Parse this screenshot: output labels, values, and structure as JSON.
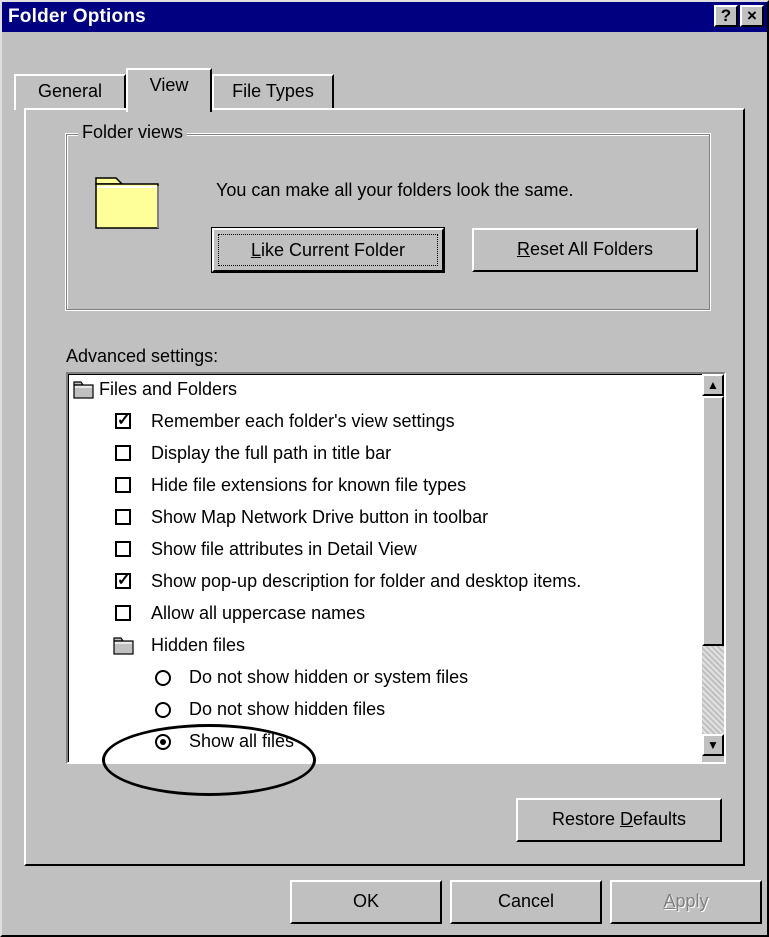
{
  "window": {
    "title": "Folder Options",
    "help_button": "?",
    "close_button": "×"
  },
  "tabs": [
    {
      "label": "General",
      "selected": false
    },
    {
      "label": "View",
      "selected": true
    },
    {
      "label": "File Types",
      "selected": false
    }
  ],
  "folder_views": {
    "legend": "Folder views",
    "description": "You can make all your folders look the same.",
    "like_current_pre": "",
    "like_current_key": "L",
    "like_current_post": "ike Current Folder",
    "reset_all_pre": "",
    "reset_all_key": "R",
    "reset_all_post": "eset All Folders"
  },
  "advanced": {
    "label": "Advanced settings:",
    "items": [
      {
        "kind": "folder",
        "label": "Files and Folders"
      },
      {
        "kind": "checkbox",
        "checked": true,
        "label": "Remember each folder's view settings"
      },
      {
        "kind": "checkbox",
        "checked": false,
        "label": "Display the full path in title bar"
      },
      {
        "kind": "checkbox",
        "checked": false,
        "label": "Hide file extensions for known file types"
      },
      {
        "kind": "checkbox",
        "checked": false,
        "label": "Show Map Network Drive button in toolbar"
      },
      {
        "kind": "checkbox",
        "checked": false,
        "label": "Show file attributes in Detail View"
      },
      {
        "kind": "checkbox",
        "checked": true,
        "label": "Show pop-up description for folder and desktop items."
      },
      {
        "kind": "checkbox",
        "checked": false,
        "label": "Allow all uppercase names"
      },
      {
        "kind": "folder",
        "label": "Hidden files"
      },
      {
        "kind": "radio",
        "checked": false,
        "label": "Do not show hidden or system files"
      },
      {
        "kind": "radio",
        "checked": false,
        "label": "Do not show hidden files"
      },
      {
        "kind": "radio",
        "checked": true,
        "label": "Show all files"
      }
    ],
    "scroll_up": "▲",
    "scroll_down": "▼"
  },
  "restore_defaults": {
    "pre": "Restore ",
    "key": "D",
    "post": "efaults"
  },
  "footer": {
    "ok": "OK",
    "cancel": "Cancel",
    "apply_key": "A",
    "apply_post": "pply"
  },
  "colors": {
    "titlebar": "#000080",
    "face": "#c0c0c0",
    "folder": "#ffff99"
  }
}
